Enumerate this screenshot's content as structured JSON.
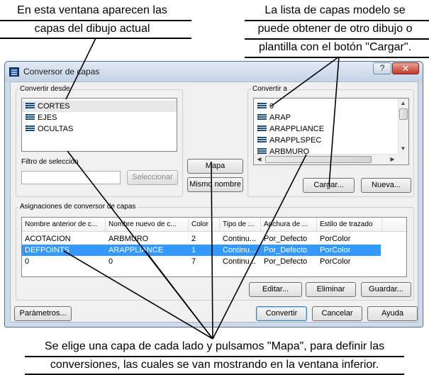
{
  "annotations": {
    "top_left_lines": [
      "En esta ventana aparecen las",
      "capas del dibujo actual"
    ],
    "top_right_lines": [
      "La lista de capas modelo se",
      "puede obtener de otro dibujo o",
      "plantilla con el botón \"Cargar\"."
    ],
    "bottom_lines": [
      "Se elige una capa de cada lado y pulsamos \"Mapa\", para definir las",
      "conversiones, las cuales se van mostrando en la ventana inferior."
    ]
  },
  "window": {
    "title": "Conversor de capas",
    "help_glyph": "?",
    "close_glyph": "✕"
  },
  "convert_from": {
    "label": "Convertir desde",
    "items": [
      "CORTES",
      "EJES",
      "OCULTAS"
    ],
    "filter_label": "Filtro de selección",
    "filter_value": "",
    "select_button": "Seleccionar"
  },
  "middle_buttons": {
    "map": "Mapa",
    "same_name": "Mismo nombre"
  },
  "convert_to": {
    "label": "Convertir a",
    "items": [
      "0",
      "ARAP",
      "ARAPPLIANCE",
      "ARAPPLSPEC",
      "ARBMURO"
    ],
    "load_button": "Cargar...",
    "new_button": "Nueva..."
  },
  "mappings": {
    "label": "Asignaciones de conversor de capas",
    "columns": [
      "Nombre anterior de c...",
      "Nombre nuevo de c...",
      "Color",
      "Tipo de ...",
      "Anchura de ...",
      "Estilo de trazado"
    ],
    "rows": [
      [
        "ACOTACION",
        "ARBMURO",
        "2",
        "Continu...",
        "Por_Defecto",
        "PorColor"
      ],
      [
        "DEFPOINTS",
        "ARAPPLIANCE",
        "1",
        "Continu...",
        "Por_Defecto",
        "PorColor"
      ],
      [
        "0",
        "0",
        "7",
        "Continu...",
        "Por_Defecto",
        "PorColor"
      ]
    ],
    "selected_row": 1,
    "edit_button": "Editar...",
    "delete_button": "Eliminar",
    "save_button": "Guardar..."
  },
  "footer": {
    "params_button": "Parámetros...",
    "convert_button": "Convertir",
    "cancel_button": "Cancelar",
    "help_button": "Ayuda"
  },
  "colors": {
    "selection": "#3399ff",
    "layer_icon": "#1e4f86",
    "window_frame": "#cfdbe8"
  }
}
